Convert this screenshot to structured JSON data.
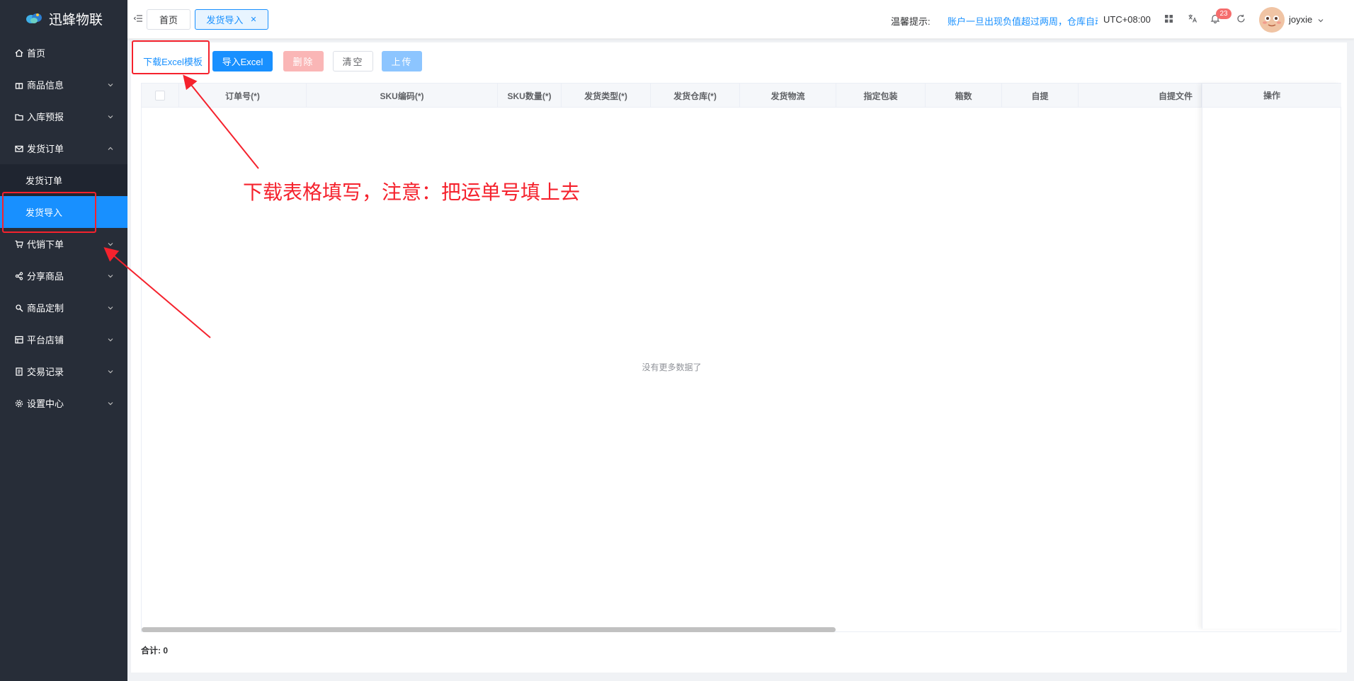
{
  "sidebar": {
    "brand": "迅蜂物联",
    "items": [
      {
        "label": "首页",
        "icon": "home-icon"
      },
      {
        "label": "商品信息",
        "icon": "gift-icon"
      },
      {
        "label": "入库预报",
        "icon": "folder-icon"
      },
      {
        "label": "发货订单",
        "icon": "envelope-icon"
      },
      {
        "label": "代销下单",
        "icon": "cart-icon"
      },
      {
        "label": "分享商品",
        "icon": "share-icon"
      },
      {
        "label": "商品定制",
        "icon": "tool-icon"
      },
      {
        "label": "平台店铺",
        "icon": "shop-icon"
      },
      {
        "label": "交易记录",
        "icon": "document-icon"
      },
      {
        "label": "设置中心",
        "icon": "gear-icon"
      }
    ],
    "sub_items": [
      {
        "label": "发货订单"
      },
      {
        "label": "发货导入"
      }
    ],
    "active_color": "#1890ff"
  },
  "header": {
    "tabs": [
      {
        "label": "首页"
      },
      {
        "label": "发货导入"
      }
    ],
    "hint_label": "温馨提示:",
    "hint_text": "账户一旦出现负值超过两周，仓库自动",
    "timezone": "UTC+08:00",
    "notification_count": "23",
    "username": "joyxie"
  },
  "toolbar": {
    "download_label": "下载Excel模板",
    "import_label": "导入Excel",
    "delete_label": "删除",
    "clear_label": "清空",
    "upload_label": "上传"
  },
  "table": {
    "columns": [
      {
        "label": "订单号(*)"
      },
      {
        "label": "SKU编码(*)"
      },
      {
        "label": "SKU数量(*)"
      },
      {
        "label": "发货类型(*)"
      },
      {
        "label": "发货仓库(*)"
      },
      {
        "label": "发货物流"
      },
      {
        "label": "指定包装"
      },
      {
        "label": "箱数"
      },
      {
        "label": "自提"
      },
      {
        "label": "自提文件"
      }
    ],
    "action_column": "操作",
    "empty_text": "没有更多数据了"
  },
  "footer": {
    "total_label": "合计:",
    "total_value": "0"
  },
  "annotation": {
    "text": "下载表格填写，注意：把运单号填上去",
    "color": "#f5222d"
  }
}
